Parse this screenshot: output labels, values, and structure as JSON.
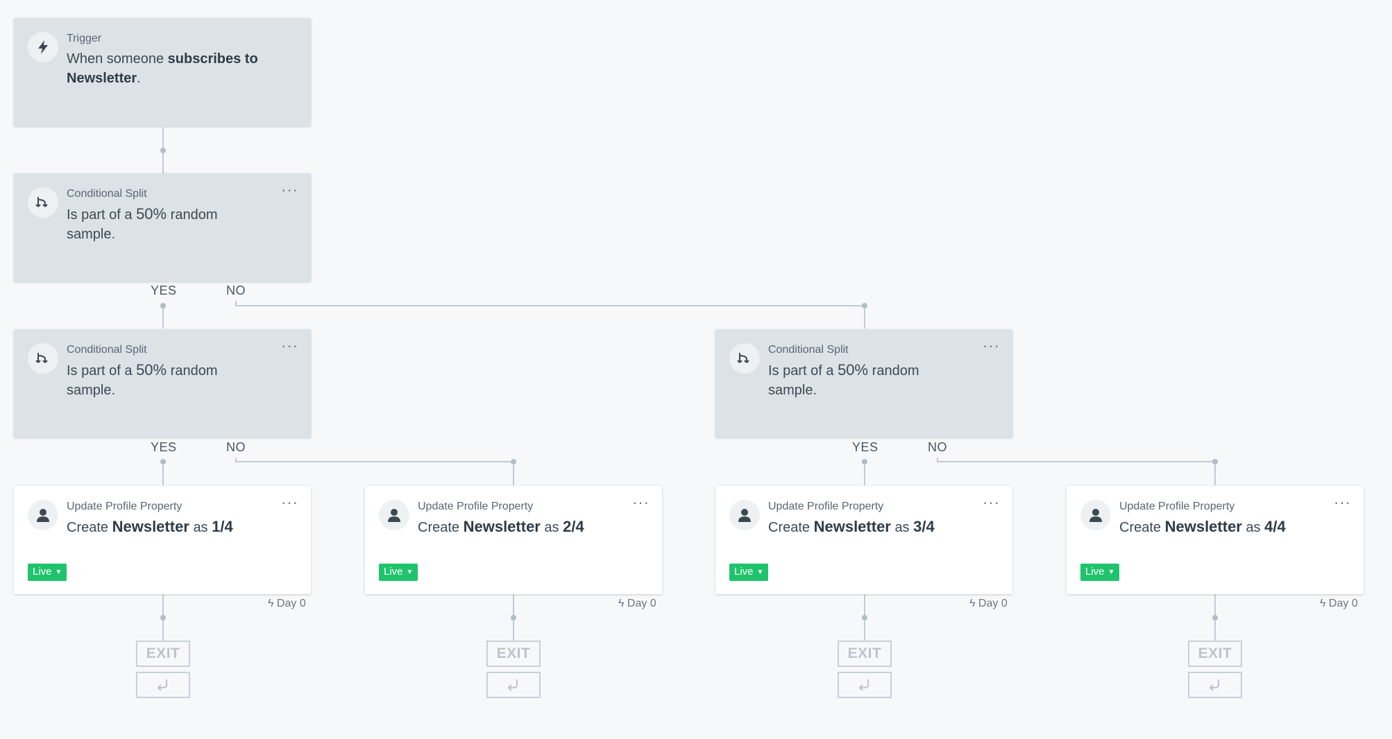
{
  "trigger": {
    "kind": "Trigger",
    "prefix": "When someone",
    "action": "subscribes to",
    "target": "Newsletter",
    "suffix": ".",
    "icon": "lightning-icon"
  },
  "splits": [
    {
      "kind": "Conditional Split",
      "prefix": "Is part of a",
      "percent": "50%",
      "suffix": "random sample.",
      "menu": "···",
      "icon": "split-icon"
    },
    {
      "kind": "Conditional Split",
      "prefix": "Is part of a",
      "percent": "50%",
      "suffix": "random sample.",
      "menu": "···",
      "icon": "split-icon"
    },
    {
      "kind": "Conditional Split",
      "prefix": "Is part of a",
      "percent": "50%",
      "suffix": "random sample.",
      "menu": "···",
      "icon": "split-icon"
    }
  ],
  "branch_labels": {
    "yes": "YES",
    "no": "NO"
  },
  "updates": [
    {
      "kind": "Update Profile Property",
      "verb": "Create",
      "property": "Newsletter",
      "as": "as",
      "value": "1/4",
      "status": "Live",
      "delay": "Day 0",
      "menu": "···"
    },
    {
      "kind": "Update Profile Property",
      "verb": "Create",
      "property": "Newsletter",
      "as": "as",
      "value": "2/4",
      "status": "Live",
      "delay": "Day 0",
      "menu": "···"
    },
    {
      "kind": "Update Profile Property",
      "verb": "Create",
      "property": "Newsletter",
      "as": "as",
      "value": "3/4",
      "status": "Live",
      "delay": "Day 0",
      "menu": "···"
    },
    {
      "kind": "Update Profile Property",
      "verb": "Create",
      "property": "Newsletter",
      "as": "as",
      "value": "4/4",
      "status": "Live",
      "delay": "Day 0",
      "menu": "···"
    }
  ],
  "exit": {
    "label": "EXIT"
  },
  "colors": {
    "live": "#1fc36b",
    "node_grey": "#dde2e7",
    "line": "#c3cad1"
  }
}
